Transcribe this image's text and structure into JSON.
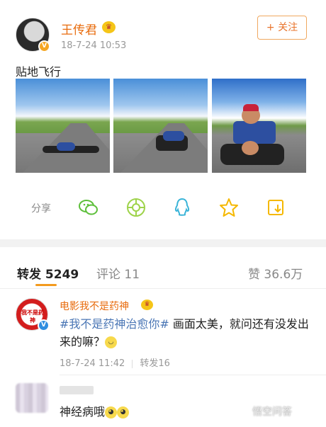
{
  "post": {
    "author": "王传君",
    "time": "18-7-24 10:53",
    "follow_label": "+ 关注",
    "text": "贴地飞行",
    "images": [
      "photo-1",
      "photo-2",
      "photo-3"
    ],
    "share_label": "分享",
    "share_icons": [
      "wechat-icon",
      "moments-icon",
      "qq-icon",
      "qzone-star-icon",
      "save-icon"
    ]
  },
  "tabs": {
    "repost": "转发 5249",
    "comment": "评论 11",
    "like": "赞 36.6万"
  },
  "comments": [
    {
      "author": "电影我不是药神",
      "avatar_text": "我不是药神",
      "tag": "#我不是药神治愈你#",
      "body": " 画面太美，就问还有没发出来的嘛？",
      "time": "18-7-24 11:42",
      "repost": "转发16"
    },
    {
      "body": "神经病哦"
    }
  ],
  "watermark": "悟空问答",
  "colors": {
    "accent": "#e86b0c",
    "link": "#4a76b5",
    "tab_underline": "#f39a1e",
    "icon_green": "#5dbf3a",
    "icon_lime": "#9ed34a",
    "icon_cyan": "#3ab4d8",
    "icon_yellow": "#f5b800"
  }
}
